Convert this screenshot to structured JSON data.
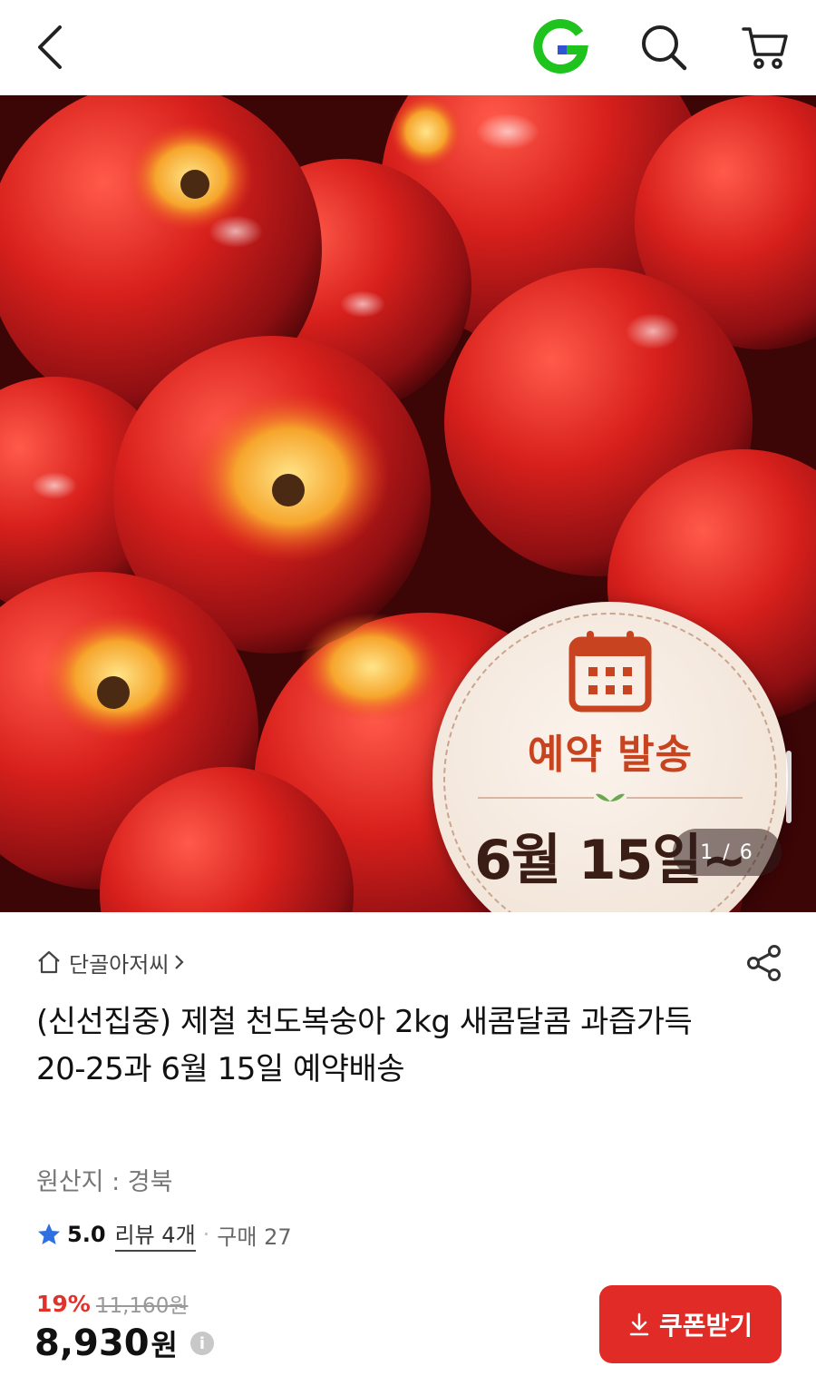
{
  "header": {
    "icons": [
      "back-icon",
      "g-logo-icon",
      "search-icon",
      "cart-icon"
    ],
    "logo_letter": "G"
  },
  "hero": {
    "badge_title": "예약 발송",
    "badge_date": "6월 15일~",
    "page_indicator": "1 / 6",
    "colors": {
      "badge_red": "#c8431f",
      "badge_text": "#3a1d14"
    }
  },
  "product": {
    "seller": "단골아저씨",
    "title": "(신선집중) 제철 천도복숭아 2kg 새콤달콤 과즙가득 20-25과 6월 15일 예약배송",
    "origin": "원산지 : 경북",
    "rating": "5.0",
    "review": "리뷰 4개",
    "separator": "·",
    "purchase": "구매 27",
    "discount": "19%",
    "original_price": "11,160원",
    "price": "8,930",
    "currency": "원",
    "info_glyph": "i",
    "coupon_label": "쿠폰받기"
  },
  "colors": {
    "accent": "#e02b27",
    "logo_green": "#1ec31e",
    "logo_blue": "#2f55d4"
  }
}
